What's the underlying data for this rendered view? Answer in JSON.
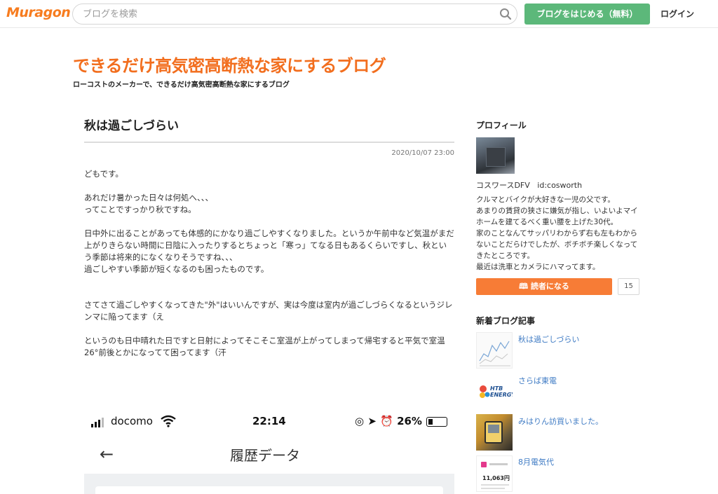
{
  "header": {
    "logo": "Muragon",
    "search_placeholder": "ブログを検索",
    "start_button": "ブログをはじめる（無料）",
    "login": "ログイン"
  },
  "blog": {
    "title": "できるだけ高気密高断熱な家にするブログ",
    "description": "ローコストのメーカーで、できるだけ高気密高断熱な家にするブログ"
  },
  "article": {
    "title": "秋は過ごしづらい",
    "date": "2020/10/07 23:00",
    "paragraphs": [
      "どもです。",
      "あれだけ暑かった日々は何処へ、、、\nってことですっかり秋ですね。",
      "日中外に出ることがあっても体感的にかなり過ごしやすくなりました。というか午前中など気温がまだ上がりきらない時間に日陰に入ったりするとちょっと「寒っ」てなる日もあるくらいですし、秋という季節は将来的になくなりそうですね、、、\n過ごしやすい季節が短くなるのも困ったものです。",
      "さてさて過ごしやすくなってきた\"外\"はいいんですが、実は今度は室内が過ごしづらくなるというジレンマに陥ってます（え",
      "というのも日中晴れた日ですと日射によってそこそこ室温が上がってしまって帰宅すると平気で室温26°前後とかになってて困ってます（汗"
    ],
    "screenshot": {
      "carrier": "docomo",
      "time": "22:14",
      "battery": "26%",
      "screen_title": "履歴データ"
    }
  },
  "sidebar": {
    "profile_heading": "プロフィール",
    "profile_name": "コスワースDFV",
    "profile_id": "id:cosworth",
    "profile_bio": "クルマとバイクが大好きな一児の父です。\nあまりの賃貸の狭さに嫌気が指し、いよいよマイホームを建てるべく重い腰を上げた30代。\n家のことなんてサッパリわからず右も左もわからないことだらけでしたが、ボチボチ楽しくなってきたところです。\n最近は洗車とカメラにハマってます。",
    "reader_button": "読者になる",
    "reader_count": "15",
    "recent_heading": "新着ブログ記事",
    "recent_posts": [
      {
        "title": "秋は過ごしづらい"
      },
      {
        "title": "さらば東電"
      },
      {
        "title": "みはりん訪買いました。"
      },
      {
        "title": "8月電気代"
      }
    ],
    "thumb_texts": {
      "energy": "HTB ENERGY",
      "bill": "11,063円"
    }
  },
  "colors": {
    "brand_orange": "#f77c1f",
    "title_orange": "#f26e1e",
    "start_green": "#5cb87a",
    "link_blue": "#3f7bc4"
  }
}
